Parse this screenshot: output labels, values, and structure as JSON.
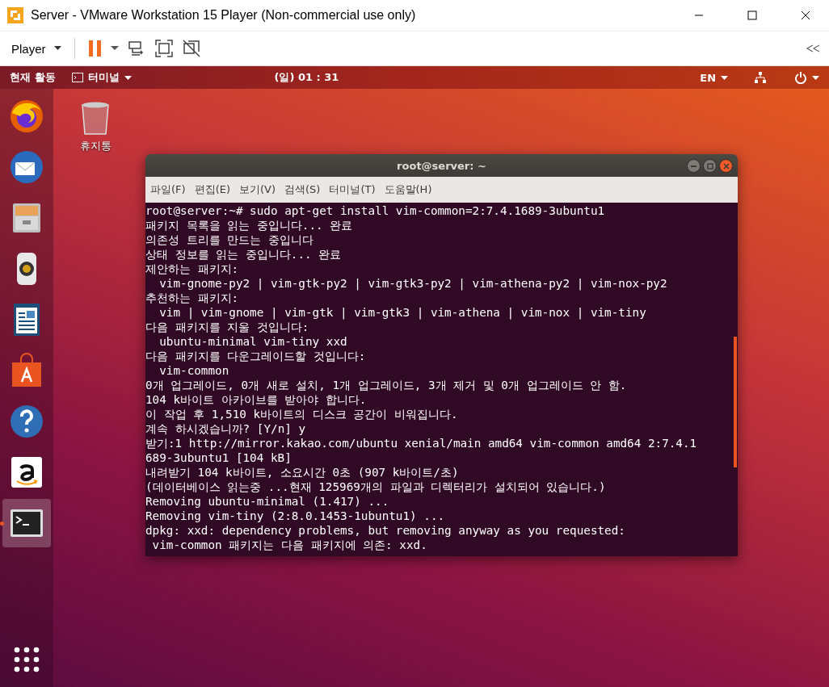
{
  "vmware": {
    "title": "Server - VMware Workstation 15 Player (Non-commercial use only)",
    "player_menu": "Player"
  },
  "topbar": {
    "activities": "현재 활동",
    "app_menu": "터미널",
    "clock": "(일) 01 : 31",
    "language": "EN"
  },
  "dock": [
    {
      "active": false
    },
    {
      "active": false
    },
    {
      "active": false
    },
    {
      "active": false
    },
    {
      "active": false
    },
    {
      "active": false
    },
    {
      "active": false
    },
    {
      "active": false
    },
    {
      "active": true
    }
  ],
  "desktop_icons": [
    {
      "label": "휴지통"
    }
  ],
  "terminal": {
    "title": "root@server: ~",
    "menu": [
      "파일(F)",
      "편집(E)",
      "보기(V)",
      "검색(S)",
      "터미널(T)",
      "도움말(H)"
    ],
    "lines": [
      "root@server:~# sudo apt-get install vim-common=2:7.4.1689-3ubuntu1",
      "패키지 목록을 읽는 중입니다... 완료",
      "의존성 트리를 만드는 중입니다",
      "상태 정보를 읽는 중입니다... 완료",
      "제안하는 패키지:",
      "  vim-gnome-py2 | vim-gtk-py2 | vim-gtk3-py2 | vim-athena-py2 | vim-nox-py2",
      "추천하는 패키지:",
      "  vim | vim-gnome | vim-gtk | vim-gtk3 | vim-athena | vim-nox | vim-tiny",
      "다음 패키지를 지울 것입니다:",
      "  ubuntu-minimal vim-tiny xxd",
      "다음 패키지를 다운그레이드할 것입니다:",
      "  vim-common",
      "0개 업그레이드, 0개 새로 설치, 1개 업그레이드, 3개 제거 및 0개 업그레이드 안 함.",
      "104 k바이트 아카이브를 받아야 합니다.",
      "이 작업 후 1,510 k바이트의 디스크 공간이 비워집니다.",
      "계속 하시겠습니까? [Y/n] y",
      "받기:1 http://mirror.kakao.com/ubuntu xenial/main amd64 vim-common amd64 2:7.4.1",
      "689-3ubuntu1 [104 kB]",
      "내려받기 104 k바이트, 소요시간 0초 (907 k바이트/초)",
      "(데이터베이스 읽는중 ...현재 125969개의 파일과 디렉터리가 설치되어 있습니다.)",
      "Removing ubuntu-minimal (1.417) ...",
      "Removing vim-tiny (2:8.0.1453-1ubuntu1) ...",
      "dpkg: xxd: dependency problems, but removing anyway as you requested:",
      " vim-common 패키지는 다음 패키지에 의존: xxd."
    ]
  }
}
